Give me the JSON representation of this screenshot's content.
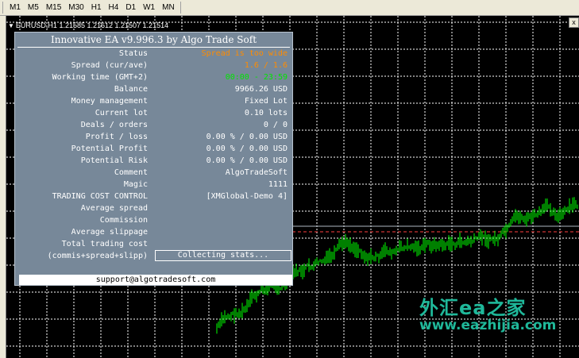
{
  "toolbar": {
    "timeframes": [
      "M1",
      "M5",
      "M15",
      "M30",
      "H1",
      "H4",
      "D1",
      "W1",
      "MN"
    ]
  },
  "chart": {
    "symbol": "EURUSD,H1",
    "quotes": "1.21585 1.21612 1.21507 1.21514",
    "close_glyph": "x",
    "candle_color": "#00ff00",
    "grid_color": "#ffffff",
    "background": "#000000"
  },
  "ea": {
    "title": "Innovative EA v9.996.3 by Algo Trade Soft",
    "rows": [
      {
        "label": "Status",
        "value": "Spread is too wide",
        "color": "orange"
      },
      {
        "label": "Spread (cur/ave)",
        "value": "1.6 / 1.6",
        "color": "orange"
      },
      {
        "label": "Working time (GMT+2)",
        "value": "00:00 - 23:59",
        "color": "green"
      },
      {
        "label": "Balance",
        "value": "9966.26 USD"
      },
      {
        "label": "Money management",
        "value": "Fixed Lot"
      },
      {
        "label": "Current lot",
        "value": "0.10 lots"
      },
      {
        "label": "Deals / orders",
        "value": "0 / 0"
      },
      {
        "label": "Profit / loss",
        "value": "0.00 % / 0.00 USD"
      },
      {
        "label": "Potential Profit",
        "value": "0.00 % / 0.00 USD"
      },
      {
        "label": "Potential Risk",
        "value": "0.00 % / 0.00 USD"
      },
      {
        "label": "Comment",
        "value": "AlgoTradeSoft"
      },
      {
        "label": "Magic",
        "value": "1111"
      },
      {
        "label": "TRADING COST CONTROL",
        "value": "[XMGlobal-Demo 4]"
      },
      {
        "label": "Average spread",
        "value": ""
      },
      {
        "label": "Commission",
        "value": ""
      },
      {
        "label": "Average slippage",
        "value": ""
      },
      {
        "label": "Total trading cost",
        "value": ""
      },
      {
        "label": "(commis+spread+slipp)",
        "value": ""
      }
    ],
    "collecting": "Collecting stats...",
    "support": "support@algotradesoft.com"
  },
  "watermark": {
    "line1": "外汇ea之家",
    "line2": "www.eazhijia.com"
  }
}
